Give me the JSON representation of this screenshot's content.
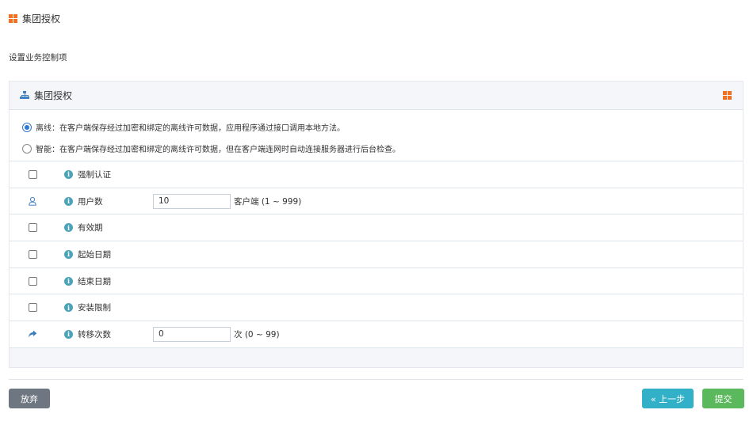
{
  "header": {
    "title": "集团授权",
    "icon": "windows-logo-icon",
    "accent": "#f37021"
  },
  "subtitle": "设置业务控制项",
  "panel": {
    "title": "集团授权",
    "title_icon": "org-chart-icon",
    "right_icon": "windows-logo-icon",
    "modes": [
      {
        "label": "离线：在客户端保存经过加密和绑定的离线许可数据，应用程序通过接口调用本地方法。",
        "checked": true
      },
      {
        "label": "智能：在客户端保存经过加密和绑定的离线许可数据，但在客户端连网时自动连接服务器进行后台检查。",
        "checked": false
      }
    ],
    "rows": [
      {
        "label": "强制认证",
        "control": "checkbox"
      },
      {
        "label": "用户数",
        "control": "user-icon",
        "value": "10",
        "suffix": "客户端 (1 ~ 999)"
      },
      {
        "label": "有效期",
        "control": "checkbox"
      },
      {
        "label": "起始日期",
        "control": "checkbox"
      },
      {
        "label": "结束日期",
        "control": "checkbox"
      },
      {
        "label": "安装限制",
        "control": "checkbox"
      },
      {
        "label": "转移次数",
        "control": "share-arrow-icon",
        "value": "0",
        "suffix": "次 (0 ~ 99)"
      }
    ]
  },
  "buttons": {
    "cancel": "放弃",
    "prev": "« 上一步",
    "submit": "提交"
  },
  "colors": {
    "info": "#4aa3b7",
    "primary": "#2e7ad1",
    "cancel": "#6e7781",
    "prev": "#31b0c7",
    "submit": "#5cb85c"
  }
}
